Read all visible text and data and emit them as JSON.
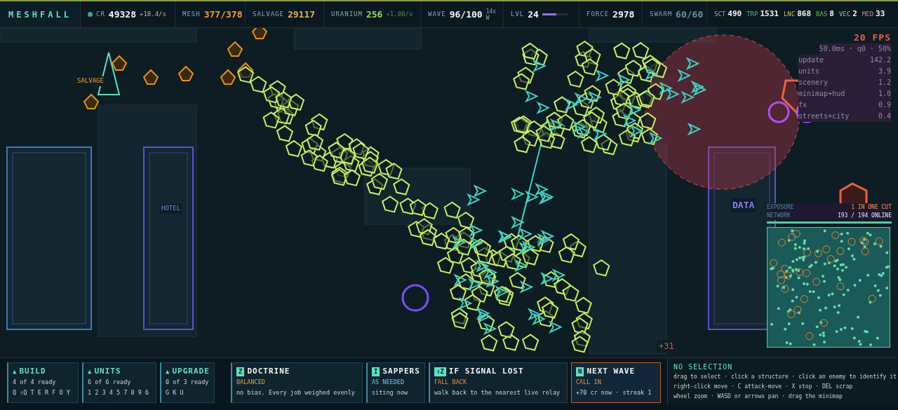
{
  "top_bar": {
    "logo": "MESHFALL",
    "stats": [
      {
        "kind": "credits",
        "label": "CR",
        "value": "49328",
        "rate": "+18.4/s"
      },
      {
        "kind": "mesh",
        "label": "MESH",
        "value": "377/378"
      },
      {
        "kind": "salvage",
        "label": "SALVAGE",
        "value": "29117"
      },
      {
        "kind": "uranium",
        "label": "URANIUM",
        "value": "256",
        "rate": "+1.00/s"
      },
      {
        "kind": "wave",
        "label": "WAVE",
        "value": "96/100",
        "timer": "14s",
        "sub": "W"
      },
      {
        "kind": "level",
        "label": "LVL",
        "value": "24",
        "level": 0.55
      },
      {
        "kind": "force",
        "label": "FORCE",
        "value": "2978"
      },
      {
        "kind": "swarm",
        "label": "SWARM",
        "value": "60/60"
      }
    ],
    "unit_counts": [
      {
        "kind": "scout",
        "label": "SCT",
        "value": "490"
      },
      {
        "kind": "trooper",
        "label": "TRP",
        "value": "1531"
      },
      {
        "kind": "lancer",
        "label": "LNC",
        "value": "868"
      },
      {
        "kind": "bastion",
        "label": "BAS",
        "value": "8"
      },
      {
        "kind": "vector",
        "label": "VEC",
        "value": "2"
      },
      {
        "kind": "medic",
        "label": "MED",
        "value": "33"
      }
    ]
  },
  "map_labels": [
    {
      "kind": "salvage",
      "text": "SALVAGE"
    },
    {
      "kind": "hotel",
      "text": "HOTEL"
    },
    {
      "kind": "data",
      "text": "DATA"
    },
    {
      "kind": "bonus",
      "text": "+31"
    }
  ],
  "perf": {
    "fps": "20 FPS",
    "summary": "50.0ms · q0 · 50%",
    "rows": [
      {
        "name": "update",
        "value": "142.2"
      },
      {
        "name": "units",
        "value": "3.9"
      },
      {
        "name": "scenery",
        "value": "1.2"
      },
      {
        "name": "minimap+hud",
        "value": "1.0"
      },
      {
        "name": "fx",
        "value": "0.9"
      },
      {
        "name": "streets+city",
        "value": "0.4"
      }
    ]
  },
  "network_panel": {
    "rows": [
      {
        "kind": "exposure",
        "label": "EXPOSURE",
        "value": "1 IN ONE CUT"
      },
      {
        "kind": "network",
        "label": "NETWORK",
        "value": "193 / 194 ONLINE"
      }
    ]
  },
  "command_groups": [
    {
      "icon": "▲",
      "title": "BUILD",
      "status": "4 of 4 ready",
      "keys": "Q ⇧Q T E R F O Y"
    },
    {
      "icon": "▲",
      "title": "UNITS",
      "status": "6 of 6 ready",
      "keys": "1 2 3 4 5 7 8 9 6"
    },
    {
      "icon": "▲",
      "title": "UPGRADE",
      "status": "0 of 3 ready",
      "keys": "G K U"
    }
  ],
  "policies": [
    {
      "kind": "doctrine",
      "key": "Z",
      "title": "DOCTRINE",
      "setting": "BALANCED",
      "description": "no bias. Every job weighed evenly",
      "highlighted": false
    },
    {
      "kind": "sappers",
      "key": "I",
      "title": "SAPPERS",
      "setting": "AS NEEDED",
      "description": "siting now",
      "highlighted": false
    },
    {
      "kind": "signal",
      "key": "⇧Z",
      "title": "IF SIGNAL LOST",
      "setting": "FALL BACK",
      "description": "walk back to the nearest live relay",
      "highlighted": false
    },
    {
      "kind": "wave",
      "key": "N",
      "title": "NEXT WAVE",
      "setting": "CALL IN",
      "description": "+70 cr now · streak 1",
      "highlighted": true
    }
  ],
  "selection": {
    "title": "NO SELECTION",
    "hints": [
      "drag to select · click a structure · click an enemy to identify it",
      "right-click move · C attack-move · X stop · DEL scrap",
      "wheel zoom · WASD or arrows pan · drag the minimap"
    ]
  }
}
